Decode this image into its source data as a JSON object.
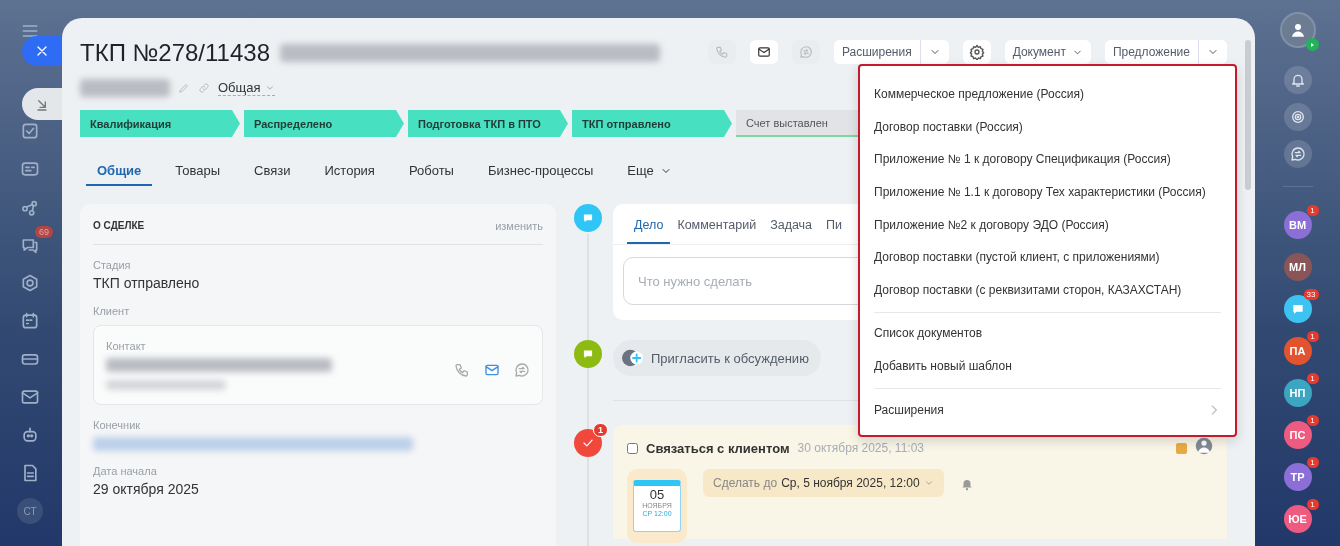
{
  "left_nav": {
    "chat_badge": "69",
    "user_initials": "СТ"
  },
  "deal": {
    "title": "ТКП №278/11438",
    "category": "Общая"
  },
  "header_actions": {
    "extensions": "Расширения",
    "document": "Документ",
    "proposal": "Предложение"
  },
  "stages": [
    {
      "label": "Квалификация",
      "passed": true
    },
    {
      "label": "Распределено",
      "passed": true
    },
    {
      "label": "Подготовка ТКП в ПТО",
      "passed": true
    },
    {
      "label": "ТКП отправлено",
      "passed": true
    },
    {
      "label": "Счет выставлен",
      "passed": false
    }
  ],
  "tabs": [
    {
      "label": "Общие",
      "selected": true,
      "dropdown": false
    },
    {
      "label": "Товары",
      "selected": false,
      "dropdown": false
    },
    {
      "label": "Связи",
      "selected": false,
      "dropdown": false
    },
    {
      "label": "История",
      "selected": false,
      "dropdown": false
    },
    {
      "label": "Роботы",
      "selected": false,
      "dropdown": false
    },
    {
      "label": "Бизнес-процессы",
      "selected": false,
      "dropdown": false
    },
    {
      "label": "Еще",
      "selected": false,
      "dropdown": true
    }
  ],
  "about": {
    "title": "О СДЕЛКЕ",
    "edit_link": "изменить",
    "fields": [
      {
        "kind": "text",
        "label": "Стадия",
        "value": "ТКП отправлено"
      },
      {
        "kind": "contact",
        "label": "Клиент",
        "contact_label": "Контакт"
      },
      {
        "kind": "redacted",
        "label": "Конечник"
      },
      {
        "kind": "text",
        "label": "Дата начала",
        "value": "29 октября 2025"
      }
    ]
  },
  "editor": {
    "tabs": [
      {
        "label": "Дело",
        "selected": true
      },
      {
        "label": "Комментарий",
        "selected": false
      },
      {
        "label": "Задача",
        "selected": false
      },
      {
        "label": "Пи",
        "selected": false
      }
    ],
    "placeholder": "Что нужно сделать"
  },
  "invite": "Пригласить к обсуждению",
  "activity": {
    "badge": "1",
    "checked": false,
    "title": "Связаться с клиентом",
    "created": "30 октября 2025, 11:03",
    "deadline_label": "Сделать до",
    "deadline": "Ср, 5 ноября 2025, 12:00",
    "calendar": {
      "day": "05",
      "month": "НОЯБРЯ",
      "weekday_time": "СР 12:00"
    }
  },
  "menu": {
    "groups": [
      [
        {
          "label": "Коммерческое предложение (Россия)",
          "submenu": false
        },
        {
          "label": "Договор поставки (Россия)",
          "submenu": false
        },
        {
          "label": "Приложение № 1 к договору Спецификация (Россия)",
          "submenu": false
        },
        {
          "label": "Приложение № 1.1 к договору Тех характеристики (Россия)",
          "submenu": false
        },
        {
          "label": "Приложение №2 к договору ЭДО (Россия)",
          "submenu": false
        },
        {
          "label": "Договор поставки (пустой клиент, с приложениями)",
          "submenu": false
        },
        {
          "label": "Договор поставки (с реквизитами сторон, КАЗАХСТАН)",
          "submenu": false
        }
      ],
      [
        {
          "label": "Список документов",
          "submenu": false
        },
        {
          "label": "Добавить новый шаблон",
          "submenu": false
        }
      ],
      [
        {
          "label": "Расширения",
          "submenu": true
        }
      ]
    ]
  },
  "right_nav": {
    "chats": [
      {
        "kind": "initials",
        "initials": "ВМ",
        "color": "#8b6fd6",
        "badge": "1"
      },
      {
        "kind": "initials",
        "initials": "МЛ",
        "color": "#8a5558"
      },
      {
        "kind": "group",
        "color": "#3cc3f2",
        "badge": "33"
      },
      {
        "kind": "initials",
        "initials": "ПА",
        "color": "#e2542f",
        "badge": "1"
      },
      {
        "kind": "initials",
        "initials": "НП",
        "color": "#3ca5c2",
        "badge": "1"
      },
      {
        "kind": "initials",
        "initials": "ПС",
        "color": "#ef5a80",
        "badge": "1"
      },
      {
        "kind": "initials",
        "initials": "ТР",
        "color": "#8b6fd6",
        "badge": "1"
      },
      {
        "kind": "initials",
        "initials": "ЮЕ",
        "color": "#ef5a80",
        "badge": "1"
      }
    ]
  }
}
